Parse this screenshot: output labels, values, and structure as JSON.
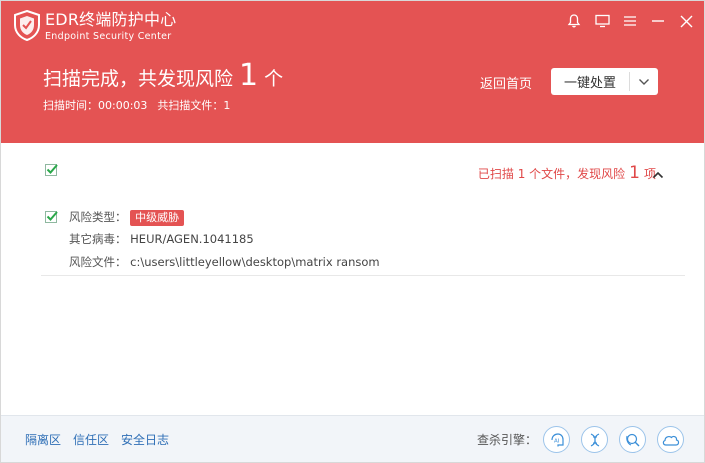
{
  "app": {
    "title": "EDR终端防护中心",
    "subtitle": "Endpoint Security Center"
  },
  "window_controls": [
    "bell-icon",
    "monitor-icon",
    "menu-icon",
    "minimize-icon",
    "close-icon"
  ],
  "scan": {
    "headline_prefix": "扫描完成，共发现风险",
    "risk_count": "1",
    "headline_suffix": "个",
    "time_label": "扫描时间：00:00:03",
    "files_label": "共扫描文件：1"
  },
  "actions": {
    "home": "返回首页",
    "dispose": "一键处置"
  },
  "summary": {
    "prefix": "已扫描 1 个文件，发现风险",
    "count": "1",
    "suffix": "项"
  },
  "item": {
    "risk_type_label": "风险类型：",
    "risk_type_value": "中级威胁",
    "virus_label": "其它病毒：",
    "virus_value": "HEUR/AGEN.1041185",
    "file_label": "风险文件：",
    "file_value": "c:\\users\\littleyellow\\desktop\\matrix ransom"
  },
  "footer": {
    "links": [
      "隔离区",
      "信任区",
      "安全日志"
    ],
    "engines_label": "查杀引擎：",
    "engines": [
      "ai-engine-icon",
      "gene-engine-icon",
      "behavior-engine-icon",
      "cloud-engine-icon"
    ]
  },
  "colors": {
    "header_bg": "#e45353",
    "accent_red": "#e04848",
    "link_blue": "#2f6fb6",
    "check_green": "#2aa84a"
  }
}
